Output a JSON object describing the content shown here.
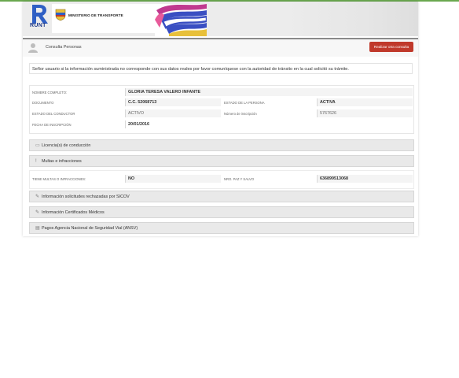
{
  "header": {
    "logo_text": "RUNT",
    "ministry": "MINISTERIO DE TRANSPORTE"
  },
  "breadcrumb": {
    "title": "Consulta Personas",
    "action_button": "Realizar otra consulta"
  },
  "notice": "Señor usuario si la información suministrada no corresponde con sus datos reales por favor comuníquese con la autoridad de tránsito en la cual solicitó su trámite.",
  "person": {
    "nombre_label": "NOMBRE COMPLETO:",
    "nombre": "GLORIA TERESA VALERO INFANTE",
    "documento_label": "DOCUMENTO",
    "documento": "C.C. 52068713",
    "estado_persona_label": "ESTADO DE LA PERSONA",
    "estado_persona": "ACTIVA",
    "estado_conductor_label": "ESTADO DEL CONDUCTOR",
    "estado_conductor": "ACTIVO",
    "inscripcion_num_label": "Número de inscripción",
    "inscripcion_num": "5767626",
    "fecha_label": "FECHA DE INSCRIPCIÓN",
    "fecha": "20/01/2016"
  },
  "sections": {
    "licencias": "Licencia(s) de conducción",
    "multas": "Multas e infracciones",
    "sicov": "Información solicitudes rechazadas por SICOV",
    "certificados": "Información Certificados Médicos",
    "ansv": "Pagos Agencia Nacional de Seguridad Vial (ANSV)"
  },
  "multas": {
    "tiene_label": "TIENE MULTAS O INFRACCIONES:",
    "tiene": "NO",
    "paz_salvo_label": "NRO. PAZ Y SALVO",
    "paz_salvo": "636899513068"
  },
  "colors": {
    "accent_button": "#c0392b",
    "top_line": "#6aa84f",
    "runt_blue": "#1f3a8a"
  }
}
